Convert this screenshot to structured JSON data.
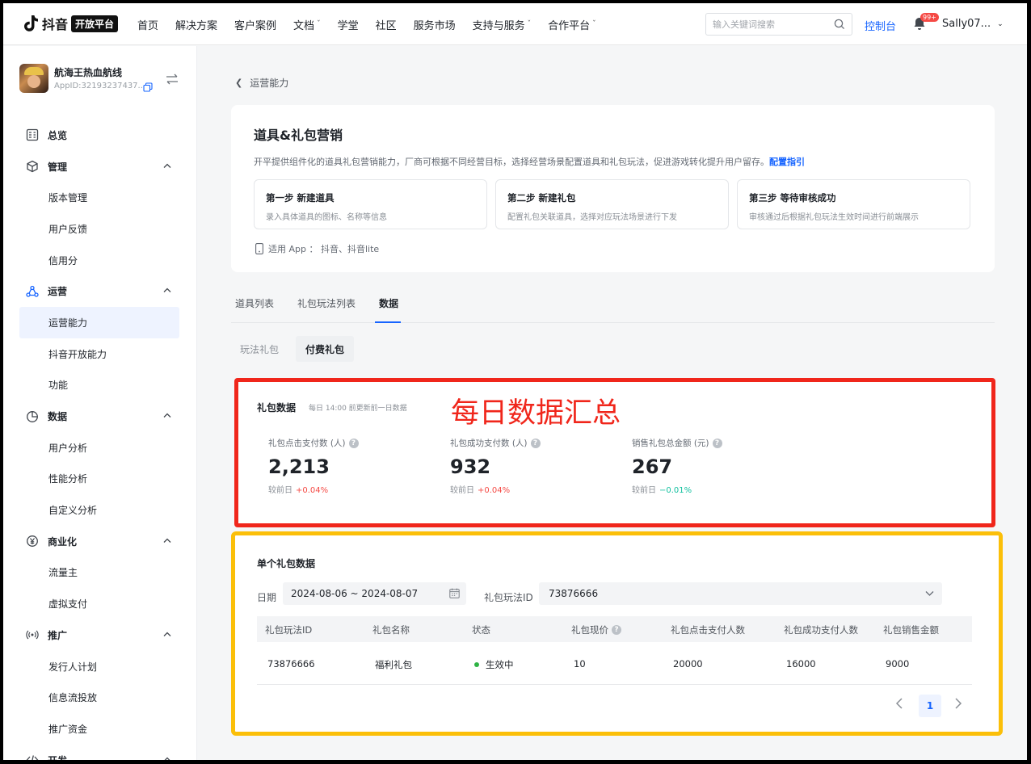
{
  "topnav": {
    "logo_text": "抖音",
    "logo_badge": "开放平台",
    "items": [
      {
        "label": "首页",
        "has_chevron": false
      },
      {
        "label": "解决方案",
        "has_chevron": false
      },
      {
        "label": "客户案例",
        "has_chevron": false
      },
      {
        "label": "文档",
        "has_chevron": true
      },
      {
        "label": "学堂",
        "has_chevron": false
      },
      {
        "label": "社区",
        "has_chevron": false
      },
      {
        "label": "服务市场",
        "has_chevron": false
      },
      {
        "label": "支持与服务",
        "has_chevron": true
      },
      {
        "label": "合作平台",
        "has_chevron": true
      }
    ],
    "search_placeholder": "输入关键词搜索",
    "console_label": "控制台",
    "notification_badge": "99+",
    "user_name": "Sally07..."
  },
  "sidebar": {
    "app_name": "航海王热血航线",
    "app_id": "AppID:32193237437...",
    "menu": [
      {
        "type": "group",
        "label": "总览",
        "icon": "dashboard-icon",
        "expandable": false
      },
      {
        "type": "group",
        "label": "管理",
        "icon": "cube-icon",
        "expandable": true
      },
      {
        "type": "sub",
        "label": "版本管理"
      },
      {
        "type": "sub",
        "label": "用户反馈"
      },
      {
        "type": "sub",
        "label": "信用分"
      },
      {
        "type": "group",
        "label": "运营",
        "icon": "operations-icon",
        "expandable": true
      },
      {
        "type": "sub",
        "label": "运营能力",
        "active": true
      },
      {
        "type": "sub",
        "label": "抖音开放能力"
      },
      {
        "type": "sub",
        "label": "功能"
      },
      {
        "type": "group",
        "label": "数据",
        "icon": "pie-chart-icon",
        "expandable": true
      },
      {
        "type": "sub",
        "label": "用户分析"
      },
      {
        "type": "sub",
        "label": "性能分析"
      },
      {
        "type": "sub",
        "label": "自定义分析"
      },
      {
        "type": "group",
        "label": "商业化",
        "icon": "yen-icon",
        "expandable": true
      },
      {
        "type": "sub",
        "label": "流量主"
      },
      {
        "type": "sub",
        "label": "虚拟支付"
      },
      {
        "type": "group",
        "label": "推广",
        "icon": "broadcast-icon",
        "expandable": true
      },
      {
        "type": "sub",
        "label": "发行人计划"
      },
      {
        "type": "sub",
        "label": "信息流投放"
      },
      {
        "type": "sub",
        "label": "推广资金"
      },
      {
        "type": "group",
        "label": "开发",
        "icon": "code-icon",
        "expandable": true
      }
    ]
  },
  "breadcrumb": {
    "back_label": "运营能力"
  },
  "intro": {
    "title": "道具&礼包营销",
    "description": "开平提供组件化的道具礼包营销能力，厂商可根据不同经营目标，选择经营场景配置道具和礼包玩法，促进游戏转化提升用户留存。",
    "guide_link": "配置指引",
    "steps": [
      {
        "title": "第一步  新建道具",
        "desc": "录入具体道具的图标、名称等信息"
      },
      {
        "title": "第二步  新建礼包",
        "desc": "配置礼包关联道具，选择对应玩法场景进行下发"
      },
      {
        "title": "第三步  等待审核成功",
        "desc": "审核通过后根据礼包玩法生效时间进行前端展示"
      }
    ],
    "applies_to": "适用 App ：  抖音、抖音lite"
  },
  "tabs": [
    {
      "label": "道具列表",
      "active": false
    },
    {
      "label": "礼包玩法列表",
      "active": false
    },
    {
      "label": "数据",
      "active": true
    }
  ],
  "segments": [
    {
      "label": "玩法礼包",
      "active": false
    },
    {
      "label": "付费礼包",
      "active": true
    }
  ],
  "daily": {
    "title": "礼包数据",
    "note": "每日 14:00 前更新前一日数据",
    "annotation": "每日数据汇总",
    "metrics": [
      {
        "label": "礼包点击支付数 (人)",
        "value": "2,213",
        "delta_label": "较前日",
        "delta": "+0.04%",
        "trend": "up"
      },
      {
        "label": "礼包成功支付数 (人)",
        "value": "932",
        "delta_label": "较前日",
        "delta": "+0.04%",
        "trend": "up"
      },
      {
        "label": "销售礼包总金额 (元)",
        "value": "267",
        "delta_label": "较前日",
        "delta": "−0.01%",
        "trend": "down"
      }
    ]
  },
  "single": {
    "title": "单个礼包数据",
    "date_label": "日期",
    "date_range": "2024-08-06 ~ 2024-08-07",
    "id_label": "礼包玩法ID",
    "id_value": "73876666",
    "columns": [
      "礼包玩法ID",
      "礼包名称",
      "状态",
      "礼包现价",
      "礼包点击支付人数",
      "礼包成功支付人数",
      "礼包销售金额"
    ],
    "rows": [
      [
        "73876666",
        "福利礼包",
        "生效中",
        "10",
        "20000",
        "16000",
        "9000"
      ]
    ],
    "page": "1"
  },
  "colors": {
    "brand_blue": "#1664ff",
    "annotation_red": "#f0261b",
    "annotation_yellow": "#fbbf09",
    "delta_up": "#f54a45",
    "delta_down": "#14c0a0",
    "status_active": "#2fb344"
  }
}
